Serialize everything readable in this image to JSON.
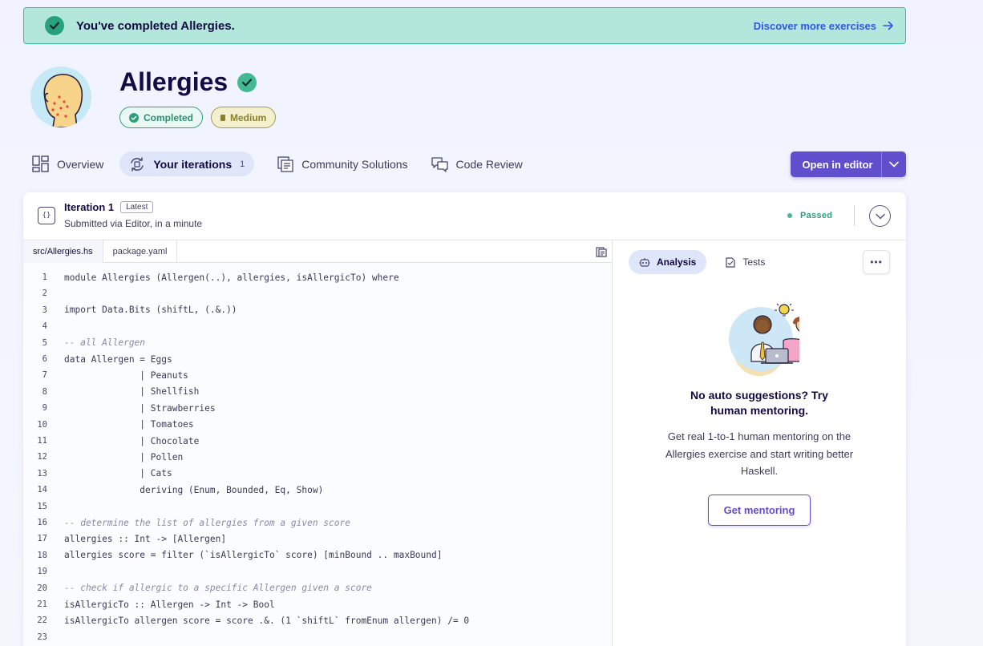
{
  "banner": {
    "text": "You've completed Allergies.",
    "link": "Discover more exercises"
  },
  "exercise": {
    "title": "Allergies",
    "status_tag": "Completed",
    "difficulty_tag": "Medium"
  },
  "tabs": [
    {
      "label": "Overview"
    },
    {
      "label": "Your iterations",
      "count": "1"
    },
    {
      "label": "Community Solutions"
    },
    {
      "label": "Code Review"
    }
  ],
  "open_editor": "Open in editor",
  "iteration": {
    "title": "Iteration 1",
    "badge": "Latest",
    "subtitle": "Submitted via Editor, in a minute",
    "status": "Passed"
  },
  "files": [
    "src/Allergies.hs",
    "package.yaml"
  ],
  "code_lines": [
    {
      "n": "1",
      "text": "module Allergies (Allergen(..), allergies, isAllergicTo) where"
    },
    {
      "n": "2",
      "text": ""
    },
    {
      "n": "3",
      "text": "import Data.Bits (shiftL, (.&.))"
    },
    {
      "n": "4",
      "text": ""
    },
    {
      "n": "5",
      "text": "-- all Allergen"
    },
    {
      "n": "6",
      "text": "data Allergen = Eggs"
    },
    {
      "n": "7",
      "text": "              | Peanuts"
    },
    {
      "n": "8",
      "text": "              | Shellfish"
    },
    {
      "n": "9",
      "text": "              | Strawberries"
    },
    {
      "n": "10",
      "text": "              | Tomatoes"
    },
    {
      "n": "11",
      "text": "              | Chocolate"
    },
    {
      "n": "12",
      "text": "              | Pollen"
    },
    {
      "n": "13",
      "text": "              | Cats"
    },
    {
      "n": "14",
      "text": "              deriving (Enum, Bounded, Eq, Show)"
    },
    {
      "n": "15",
      "text": ""
    },
    {
      "n": "16",
      "text": "-- determine the list of allergies from a given score"
    },
    {
      "n": "17",
      "text": "allergies :: Int -> [Allergen]"
    },
    {
      "n": "18",
      "text": "allergies score = filter (`isAllergicTo` score) [minBound .. maxBound]"
    },
    {
      "n": "19",
      "text": ""
    },
    {
      "n": "20",
      "text": "-- check if allergic to a specific Allergen given a score"
    },
    {
      "n": "21",
      "text": "isAllergicTo :: Allergen -> Int -> Bool"
    },
    {
      "n": "22",
      "text": "isAllergicTo allergen score = score .&. (1 `shiftL` fromEnum allergen) /= 0"
    },
    {
      "n": "23",
      "text": ""
    }
  ],
  "analysis": {
    "tabs": [
      "Analysis",
      "Tests"
    ],
    "more": "•••",
    "heading": "No auto suggestions? Try human mentoring.",
    "description": "Get real 1-to-1 human mentoring on the Allergies exercise and start writing better Haskell.",
    "button": "Get mentoring"
  },
  "colors": {
    "accent": "#604fcd",
    "success": "#43b993",
    "link": "#2e57e8"
  }
}
